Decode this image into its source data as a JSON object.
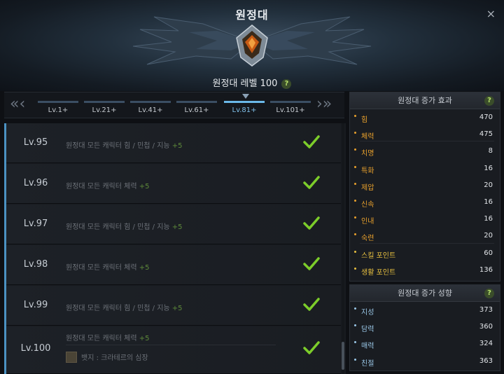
{
  "window": {
    "title": "원정대",
    "close_label": "×"
  },
  "header": {
    "level_label": "원정대 레벨 100",
    "help_label": "?"
  },
  "tabs": {
    "prev_label": "«‹",
    "next_label": "›»",
    "items": [
      {
        "label": "Lv.1+",
        "active": false
      },
      {
        "label": "Lv.21+",
        "active": false
      },
      {
        "label": "Lv.41+",
        "active": false
      },
      {
        "label": "Lv.61+",
        "active": false
      },
      {
        "label": "Lv.81+",
        "active": true
      },
      {
        "label": "Lv.101+",
        "active": false
      }
    ]
  },
  "levels": [
    {
      "level": "Lv.95",
      "desc": "원정대 모든 캐릭터 힘 / 민첩 / 지능",
      "bonus": "+5",
      "completed": true
    },
    {
      "level": "Lv.96",
      "desc": "원정대 모든 캐릭터 체력",
      "bonus": "+5",
      "completed": true
    },
    {
      "level": "Lv.97",
      "desc": "원정대 모든 캐릭터 힘 / 민첩 / 지능",
      "bonus": "+5",
      "completed": true
    },
    {
      "level": "Lv.98",
      "desc": "원정대 모든 캐릭터 체력",
      "bonus": "+5",
      "completed": true
    },
    {
      "level": "Lv.99",
      "desc": "원정대 모든 캐릭터 힘 / 민첩 / 지능",
      "bonus": "+5",
      "completed": true
    },
    {
      "level": "Lv.100",
      "desc": "원정대 모든 캐릭터 체력",
      "bonus": "+5",
      "badge": "뱃지 : 크라테르의 심장",
      "completed": true
    }
  ],
  "effects_panel": {
    "title": "원정대 증가 효과",
    "help_label": "?",
    "stats": [
      {
        "name": "힘",
        "value": "470",
        "color": "#e8a02c"
      },
      {
        "name": "체력",
        "value": "475",
        "color": "#e8a02c"
      },
      {
        "name": "치명",
        "value": "8",
        "color": "#e8a02c"
      },
      {
        "name": "특화",
        "value": "16",
        "color": "#e8a02c"
      },
      {
        "name": "제압",
        "value": "20",
        "color": "#e8a02c"
      },
      {
        "name": "신속",
        "value": "16",
        "color": "#e8a02c"
      },
      {
        "name": "인내",
        "value": "16",
        "color": "#e8a02c"
      },
      {
        "name": "숙련",
        "value": "20",
        "color": "#e8a02c"
      },
      {
        "name": "스킬 포인트",
        "value": "60",
        "color": "#e8c040"
      },
      {
        "name": "생활 포인트",
        "value": "136",
        "color": "#e8c040"
      }
    ]
  },
  "traits_panel": {
    "title": "원정대 증가 성향",
    "help_label": "?",
    "stats": [
      {
        "name": "지성",
        "value": "373",
        "color": "#9ac8e8"
      },
      {
        "name": "담력",
        "value": "360",
        "color": "#9ac8e8"
      },
      {
        "name": "매력",
        "value": "324",
        "color": "#9ac8e8"
      },
      {
        "name": "친절",
        "value": "363",
        "color": "#9ac8e8"
      }
    ]
  },
  "colors": {
    "accent": "#6ab8e8",
    "check": "#7ccd2a",
    "bonus": "#5e8a3a"
  }
}
